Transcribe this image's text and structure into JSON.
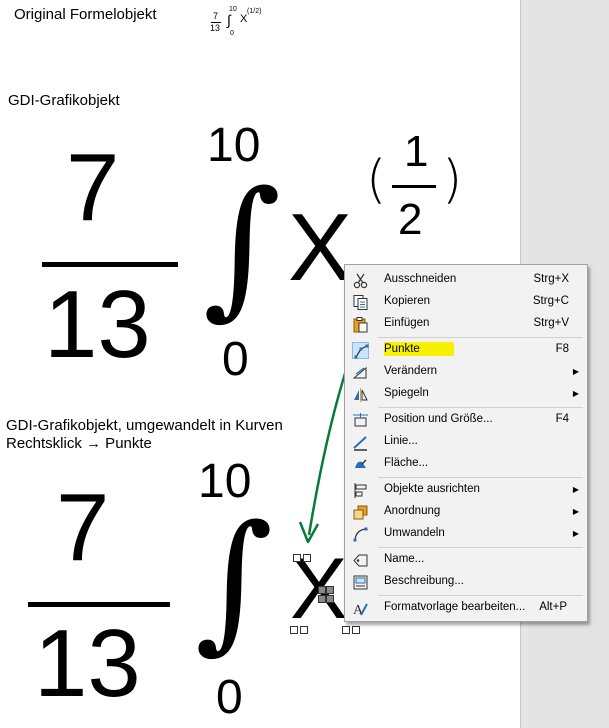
{
  "headings": {
    "original": "Original Formelobjekt",
    "gdi": "GDI-Grafikobjekt",
    "converted_line1": "GDI-Grafikobjekt, umgewandelt in Kurven",
    "converted_line2": "Rechtsklick → Punkte"
  },
  "formula": {
    "numerator": "7",
    "denominator": "13",
    "upper_limit": "10",
    "lower_limit": "0",
    "integral": "∫",
    "variable": "X",
    "exp_numerator": "1",
    "exp_denominator": "2",
    "lparen": "(",
    "rparen": ")"
  },
  "menu": {
    "items": [
      {
        "label": "Ausschneiden",
        "shortcut": "Strg+X",
        "icon": "scissors-icon"
      },
      {
        "label": "Kopieren",
        "shortcut": "Strg+C",
        "icon": "copy-icon"
      },
      {
        "label": "Einfügen",
        "shortcut": "Strg+V",
        "icon": "paste-icon"
      },
      {
        "label": "Punkte",
        "shortcut": "F8",
        "icon": "points-icon",
        "highlighted": true
      },
      {
        "label": "Verändern",
        "shortcut": "",
        "icon": "transform-icon",
        "submenu": true
      },
      {
        "label": "Spiegeln",
        "shortcut": "",
        "icon": "mirror-icon",
        "submenu": true
      },
      {
        "label": "Position und Größe...",
        "shortcut": "F4",
        "icon": "position-size-icon"
      },
      {
        "label": "Linie...",
        "shortcut": "",
        "icon": "line-icon"
      },
      {
        "label": "Fläche...",
        "shortcut": "",
        "icon": "area-icon"
      },
      {
        "label": "Objekte ausrichten",
        "shortcut": "",
        "icon": "align-icon",
        "submenu": true
      },
      {
        "label": "Anordnung",
        "shortcut": "",
        "icon": "arrange-icon",
        "submenu": true
      },
      {
        "label": "Umwandeln",
        "shortcut": "",
        "icon": "convert-icon",
        "submenu": true
      },
      {
        "label": "Name...",
        "shortcut": "",
        "icon": "name-icon"
      },
      {
        "label": "Beschreibung...",
        "shortcut": "",
        "icon": "description-icon"
      },
      {
        "label": "Formatvorlage bearbeiten...",
        "shortcut": "Alt+P",
        "icon": "edit-style-icon"
      }
    ]
  },
  "colors": {
    "highlight": "#f7f000",
    "arrow": "#0a7a3a",
    "menu_bg": "#f2f2f2",
    "icon_blue": "#2a6fb5",
    "icon_orange": "#e8a020"
  }
}
